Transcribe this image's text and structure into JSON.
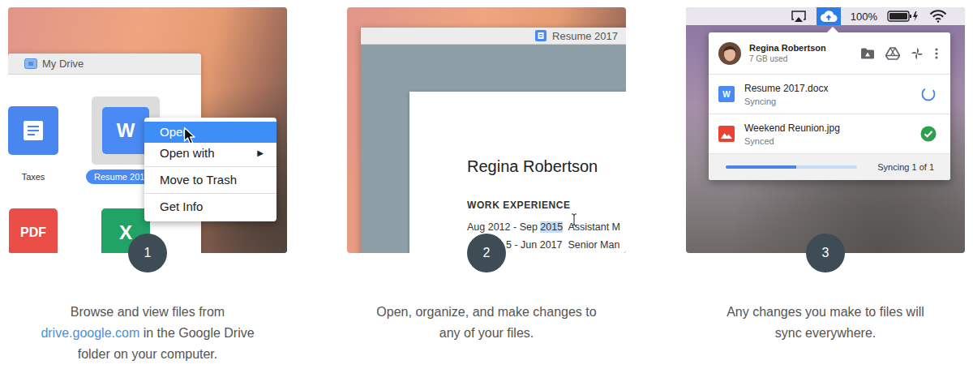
{
  "steps": [
    {
      "number": "1",
      "caption": [
        [
          {
            "text": "Browse and view files from",
            "link": false
          }
        ],
        [
          {
            "text": "drive.google.com",
            "link": true
          },
          {
            "text": " in the Google Drive",
            "link": false
          }
        ],
        [
          {
            "text": "folder on your computer.",
            "link": false
          }
        ]
      ]
    },
    {
      "number": "2",
      "caption": [
        [
          {
            "text": "Open, organize, and make changes to",
            "link": false
          }
        ],
        [
          {
            "text": "any of your files.",
            "link": false
          }
        ]
      ]
    },
    {
      "number": "3",
      "caption": [
        [
          {
            "text": "Any changes you make to files will",
            "link": false
          }
        ],
        [
          {
            "text": "sync everywhere.",
            "link": false
          }
        ]
      ]
    }
  ],
  "finder": {
    "title": "My Drive",
    "files": [
      {
        "name": "Taxes",
        "kind": "doc",
        "selected": false
      },
      {
        "name": "Resume 201",
        "kind": "word",
        "badge": "W",
        "selected": true
      },
      {
        "kind": "pdf",
        "badge": "PDF",
        "selected": false
      },
      {
        "kind": "xls",
        "badge": "X",
        "selected": false
      }
    ],
    "context_menu": [
      {
        "kind": "item",
        "label": "Open",
        "selected": true
      },
      {
        "kind": "item",
        "label": "Open with",
        "submenu": "▶",
        "selected": false
      },
      {
        "kind": "separator"
      },
      {
        "kind": "item",
        "label": "Move to Trash",
        "selected": false
      },
      {
        "kind": "separator"
      },
      {
        "kind": "item",
        "label": "Get Info",
        "selected": false
      }
    ]
  },
  "editor": {
    "title": "Resume 2017",
    "name": "Regina Robertson",
    "heading": "WORK EXPERIENCE",
    "rows": [
      [
        {
          "text": "Aug 2012 - Sep ",
          "highlighted": false
        },
        {
          "text": "2015",
          "highlighted": true
        },
        {
          "text": "  Assistant M",
          "highlighted": false
        }
      ],
      [
        {
          "text": "5 - Jun 2017  Senior Man",
          "highlighted": false
        }
      ]
    ]
  },
  "sync": {
    "menubar": {
      "battery": "100%",
      "drive_selected": true
    },
    "account": {
      "name": "Regina Robertson",
      "usage": "7 GB used"
    },
    "files": [
      {
        "name": "Resume 2017.docx",
        "status": "Syncing",
        "kind": "doc",
        "badge": "W",
        "synced": false
      },
      {
        "name": "Weekend Reunion.jpg",
        "status": "Synced",
        "kind": "image",
        "synced": true
      }
    ],
    "progress": {
      "level": 0.54,
      "label": "Syncing 1 of 1"
    }
  }
}
